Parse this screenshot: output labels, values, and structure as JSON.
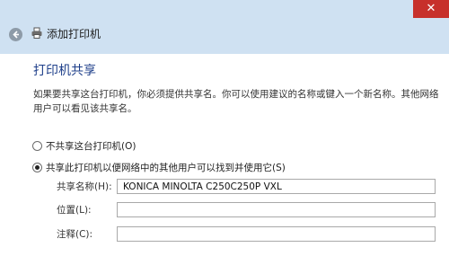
{
  "window": {
    "title": "添加打印机",
    "close_glyph": "✕"
  },
  "page": {
    "heading": "打印机共享",
    "description": "如果要共享这台打印机，你必须提供共享名。你可以使用建议的名称或键入一个新名称。其他网络用户可以看见该共享名。"
  },
  "options": {
    "no_share_label": "不共享这台打印机(O)",
    "share_label": "共享此打印机以便网络中的其他用户可以找到并使用它(S)",
    "selected": "share"
  },
  "fields": {
    "share_name_label": "共享名称(H):",
    "share_name_value": "KONICA MINOLTA C250C250P VXL",
    "location_label": "位置(L):",
    "location_value": "",
    "comment_label": "注释(C):",
    "comment_value": ""
  },
  "icons": {
    "back": "back-arrow-icon",
    "printer": "printer-icon",
    "close": "close-icon"
  },
  "colors": {
    "chrome_bg": "#cfe1f2",
    "heading": "#1e3f8a",
    "close_bg": "#c7302b"
  }
}
